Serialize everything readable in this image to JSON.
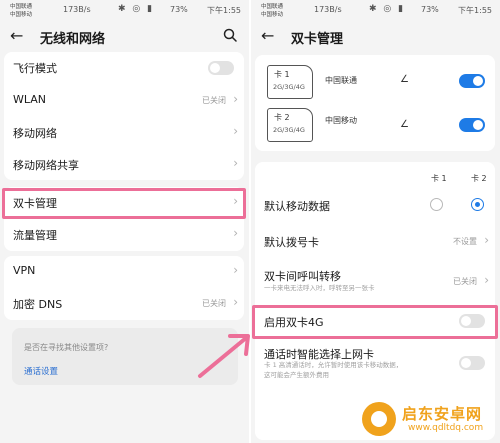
{
  "status_bar": {
    "carrier_line1": "中国联通",
    "carrier_line2": "中国移动",
    "speed": "173B/s",
    "battery": "73%",
    "time": "下午1:55"
  },
  "left_screen": {
    "title": "无线和网络",
    "items": [
      {
        "label": "飞行模式",
        "control": "toggle",
        "state": "off"
      },
      {
        "label": "WLAN",
        "value": "已关闭",
        "control": "chevron"
      },
      {
        "label": "移动网络",
        "control": "chevron"
      },
      {
        "label": "移动网络共享",
        "control": "chevron"
      },
      {
        "label": "双卡管理",
        "control": "chevron",
        "highlighted": true
      },
      {
        "label": "流量管理",
        "control": "chevron"
      },
      {
        "label": "VPN",
        "control": "chevron"
      },
      {
        "label": "加密 DNS",
        "value": "已关闭",
        "control": "chevron"
      }
    ],
    "suggestion": {
      "title": "是否在寻找其他设置项?",
      "link": "通话设置"
    }
  },
  "right_screen": {
    "title": "双卡管理",
    "sims": [
      {
        "slot": "卡 1",
        "network": "2G/3G/4G",
        "carrier": "中国联通",
        "enabled": true
      },
      {
        "slot": "卡 2",
        "network": "2G/3G/4G",
        "carrier": "中国移动",
        "enabled": true
      }
    ],
    "columns": {
      "card1": "卡 1",
      "card2": "卡 2"
    },
    "default_data": {
      "label": "默认移动数据",
      "selected": "卡 2"
    },
    "default_dial": {
      "label": "默认拨号卡",
      "value": "不设置"
    },
    "call_forward": {
      "label": "双卡间呼叫转移",
      "sub": "一卡来电无法呼入时，呼转至另一张卡",
      "value": "已关闭"
    },
    "dual_4g": {
      "label": "启用双卡4G",
      "state": "off"
    },
    "smart_data": {
      "label": "通话时智能选择上网卡",
      "sub1": "卡 1 高清通话时，允许暂时使用该卡移动数据，",
      "sub2": "这可能会产生额外费用",
      "state": "off"
    }
  },
  "watermark": {
    "name": "启东安卓网",
    "url": "www.qdltdq.com"
  },
  "colors": {
    "accent": "#1e7be6",
    "highlight": "#ec6f98",
    "watermark": "#f0a21c"
  }
}
